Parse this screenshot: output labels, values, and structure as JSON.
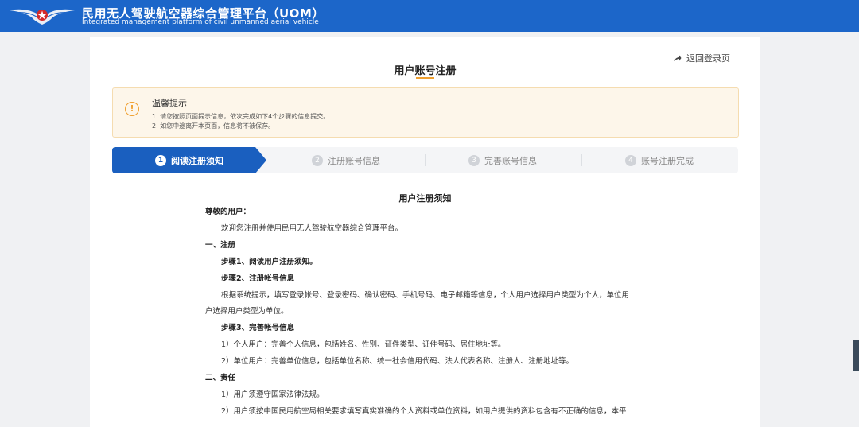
{
  "header": {
    "title": "民用无人驾驶航空器综合管理平台（UOM）",
    "subtitle": "Integrated management platform of civil unmanned aerial vehicle",
    "colors": {
      "bar": "#1c66c9"
    }
  },
  "card": {
    "back_label": "返回登录页",
    "title": "用户账号注册"
  },
  "notice": {
    "icon": "warning-circle-icon",
    "title": "温馨提示",
    "lines": [
      "1. 请您按照页面提示信息，依次完成如下4个步骤的信息提交。",
      "2. 如您中途离开本页面，信息将不被保存。"
    ]
  },
  "steps": [
    {
      "num": "1",
      "label": "阅读注册须知",
      "active": true
    },
    {
      "num": "2",
      "label": "注册账号信息",
      "active": false
    },
    {
      "num": "3",
      "label": "完善账号信息",
      "active": false
    },
    {
      "num": "4",
      "label": "账号注册完成",
      "active": false
    }
  ],
  "agreement": {
    "title": "用户注册须知",
    "paragraphs": [
      "尊敬的用户：",
      "欢迎您注册并使用民用无人驾驶航空器综合管理平台。",
      "一、注册",
      "步骤1、阅读用户注册须知。",
      "步骤2、注册帐号信息",
      "根据系统提示，填写登录帐号、登录密码、确认密码、手机号码、电子邮箱等信息，个人用户选择用户类型为个人，单位用",
      "户选择用户类型为单位。",
      "步骤3、完善帐号信息",
      "1）个人用户：完善个人信息，包括姓名、性别、证件类型、证件号码、居住地址等。",
      "2）单位用户：完善单位信息，包括单位名称、统一社会信用代码、法人代表名称、注册人、注册地址等。",
      "二、责任",
      "1）用户须遵守国家法律法规。",
      "2）用户须按中国民用航空局相关要求填写真实准确的个人资料或单位资料，如用户提供的资料包含有不正确的信息，本平"
    ]
  }
}
